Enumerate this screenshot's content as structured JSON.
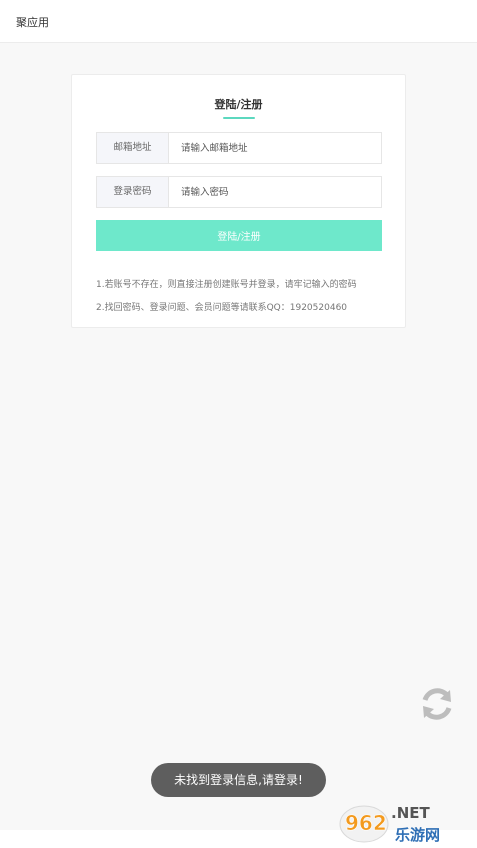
{
  "header": {
    "app_title": "聚应用"
  },
  "login_card": {
    "title": "登陆/注册",
    "email": {
      "label": "邮箱地址",
      "placeholder": "请输入邮箱地址"
    },
    "password": {
      "label": "登录密码",
      "placeholder": "请输入密码"
    },
    "submit_label": "登陆/注册",
    "notes": [
      "1.若账号不存在，则直接注册创建账号并登录，请牢记输入的密码",
      "2.找回密码、登录问题、会员问题等请联系QQ：1920520460"
    ]
  },
  "toast": {
    "message": "未找到登录信息,请登录!"
  },
  "watermark": {
    "text": "962.NET 乐游网"
  },
  "icons": {
    "refresh": "refresh-icon"
  },
  "colors": {
    "accent": "#6ee8cb",
    "underline": "#5cd8bf",
    "toast_bg": "#5e5e5e",
    "background": "#f8f8f8"
  }
}
